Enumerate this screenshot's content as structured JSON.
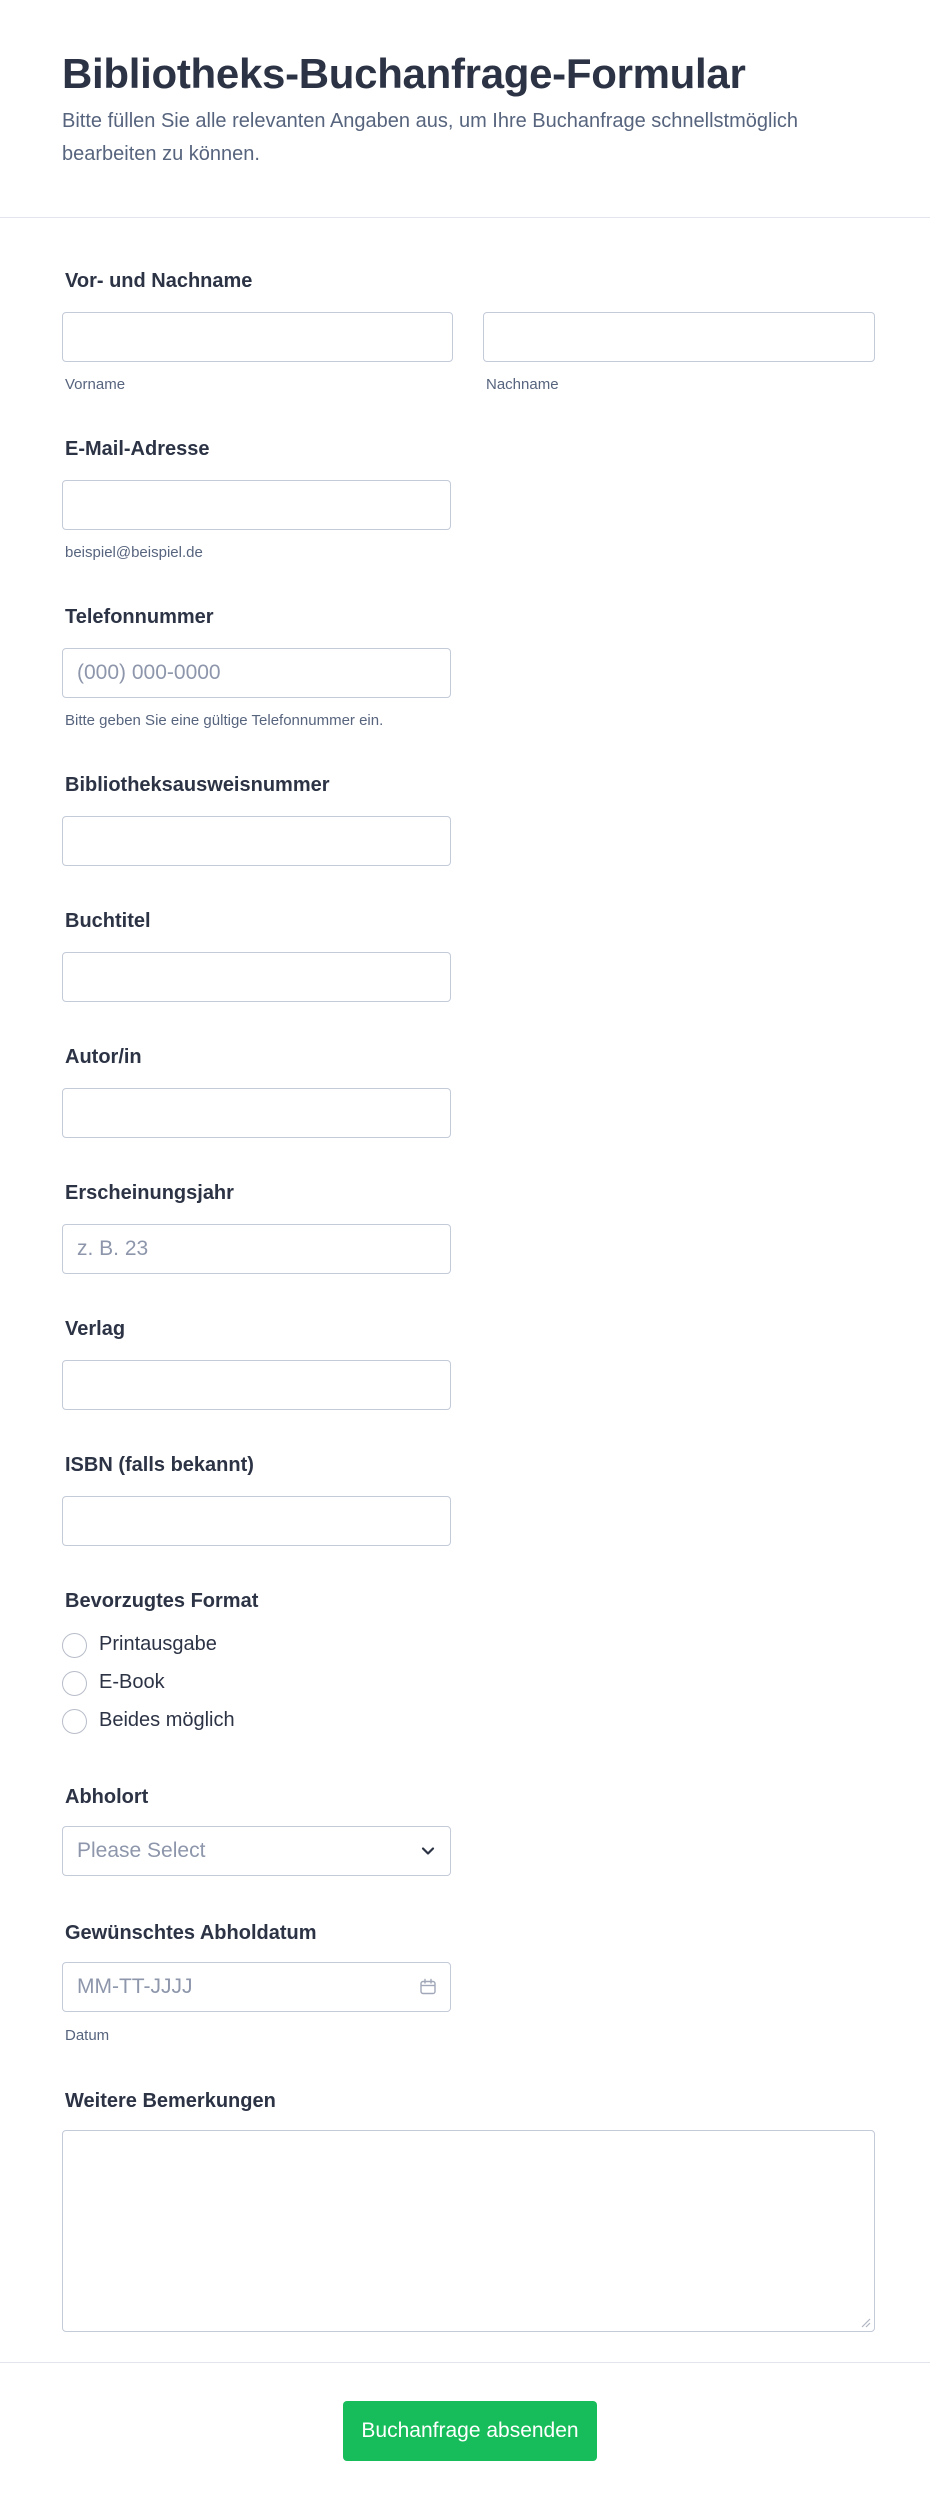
{
  "form": {
    "title": "Bibliotheks-Buchanfrage-Formular",
    "subtitle": "Bitte füllen Sie alle relevanten Angaben aus, um Ihre Buchanfrage schnellstmöglich bearbeiten zu können."
  },
  "name": {
    "label": "Vor- und Nachname",
    "first_sub": "Vorname",
    "last_sub": "Nachname"
  },
  "email": {
    "label": "E-Mail-Adresse",
    "sub": "beispiel@beispiel.de"
  },
  "phone": {
    "label": "Telefonnummer",
    "placeholder": "(000) 000-0000",
    "sub": "Bitte geben Sie eine gültige Telefonnummer ein."
  },
  "library_card": {
    "label": "Bibliotheksausweisnummer"
  },
  "book_title": {
    "label": "Buchtitel"
  },
  "author": {
    "label": "Autor/in"
  },
  "year": {
    "label": "Erscheinungsjahr",
    "placeholder": "z. B. 23"
  },
  "publisher": {
    "label": "Verlag"
  },
  "isbn": {
    "label": "ISBN (falls bekannt)"
  },
  "format": {
    "label": "Bevorzugtes Format",
    "options": [
      "Printausgabe",
      "E-Book",
      "Beides möglich"
    ]
  },
  "pickup_location": {
    "label": "Abholort",
    "placeholder": "Please Select"
  },
  "pickup_date": {
    "label": "Gewünschtes Abholdatum",
    "placeholder": "MM-TT-JJJJ",
    "sub": "Datum"
  },
  "remarks": {
    "label": "Weitere Bemerkungen"
  },
  "submit": {
    "label": "Buchanfrage absenden"
  },
  "colors": {
    "accent": "#18bd5b",
    "text": "#2c3345",
    "muted": "#57647e",
    "border": "#c3cad8"
  }
}
